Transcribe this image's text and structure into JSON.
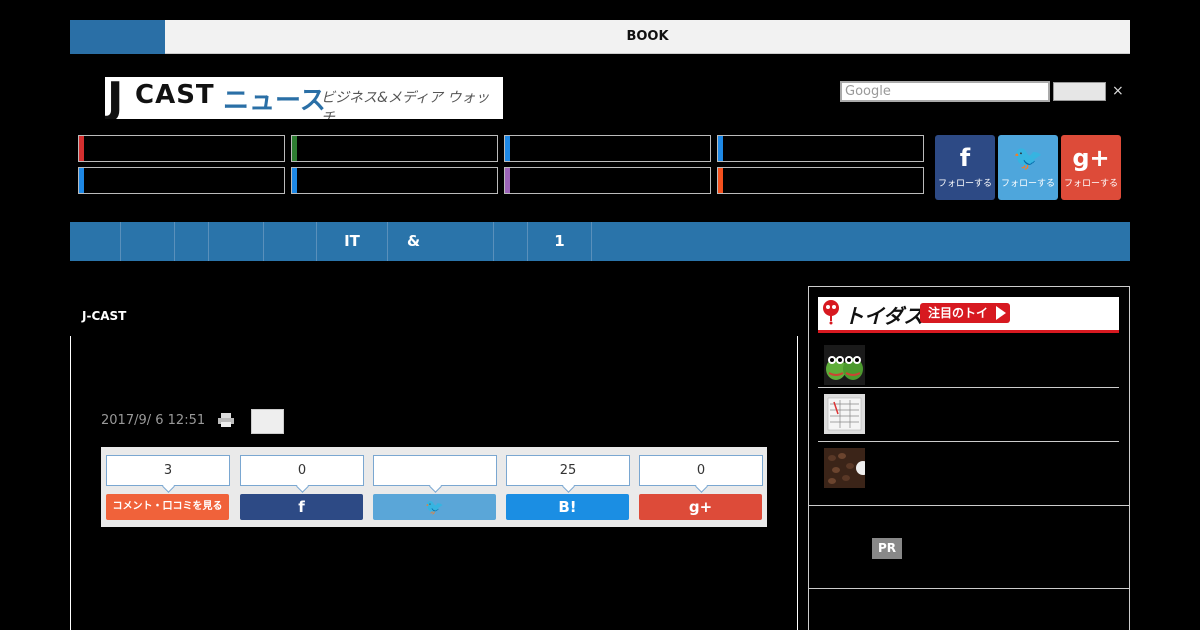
{
  "topbar": {
    "label": "BOOK"
  },
  "logo": {
    "j": "J",
    "cast": "CAST",
    "news": "ニュース",
    "sub": "ビジネス&メディア ウォッチ"
  },
  "search": {
    "placeholder": "Google",
    "close": "×"
  },
  "categories": {
    "colors": [
      "#d32f2f",
      "#2e7d32",
      "#1e88e5",
      "#1e88e5",
      "#1e88e5",
      "#1e88e5",
      "#9c64b8",
      "#f4511e"
    ]
  },
  "social": [
    {
      "icon": "facebook-icon",
      "glyph": "f",
      "label": "フォローする",
      "color": "#2d4a85"
    },
    {
      "icon": "twitter-icon",
      "glyph": "🐦",
      "label": "フォローする",
      "color": "#4ea6dc"
    },
    {
      "icon": "googleplus-icon",
      "glyph": "g+",
      "label": "フォローする",
      "color": "#dd4b39"
    }
  ],
  "nav": {
    "items": [
      "",
      "",
      "",
      "",
      "",
      "IT",
      "&",
      "",
      "1"
    ]
  },
  "article": {
    "breadcrumb": "J-CAST",
    "date": "2017/9/ 6 12:51"
  },
  "share": {
    "counts": [
      "3",
      "0",
      "",
      "25",
      "0"
    ],
    "buttons": [
      {
        "label": "コメント・口コミを見る",
        "color": "#f0623a"
      },
      {
        "label": "f",
        "color": "#2d4a85"
      },
      {
        "label": "🐦",
        "color": "#5aa6d8"
      },
      {
        "label": "B!",
        "color": "#1b8ee3"
      },
      {
        "label": "g+",
        "color": "#dd4b39"
      }
    ]
  },
  "sidebar": {
    "brand": "トイダス",
    "tag": "注目のトイ",
    "pr": "PR"
  }
}
